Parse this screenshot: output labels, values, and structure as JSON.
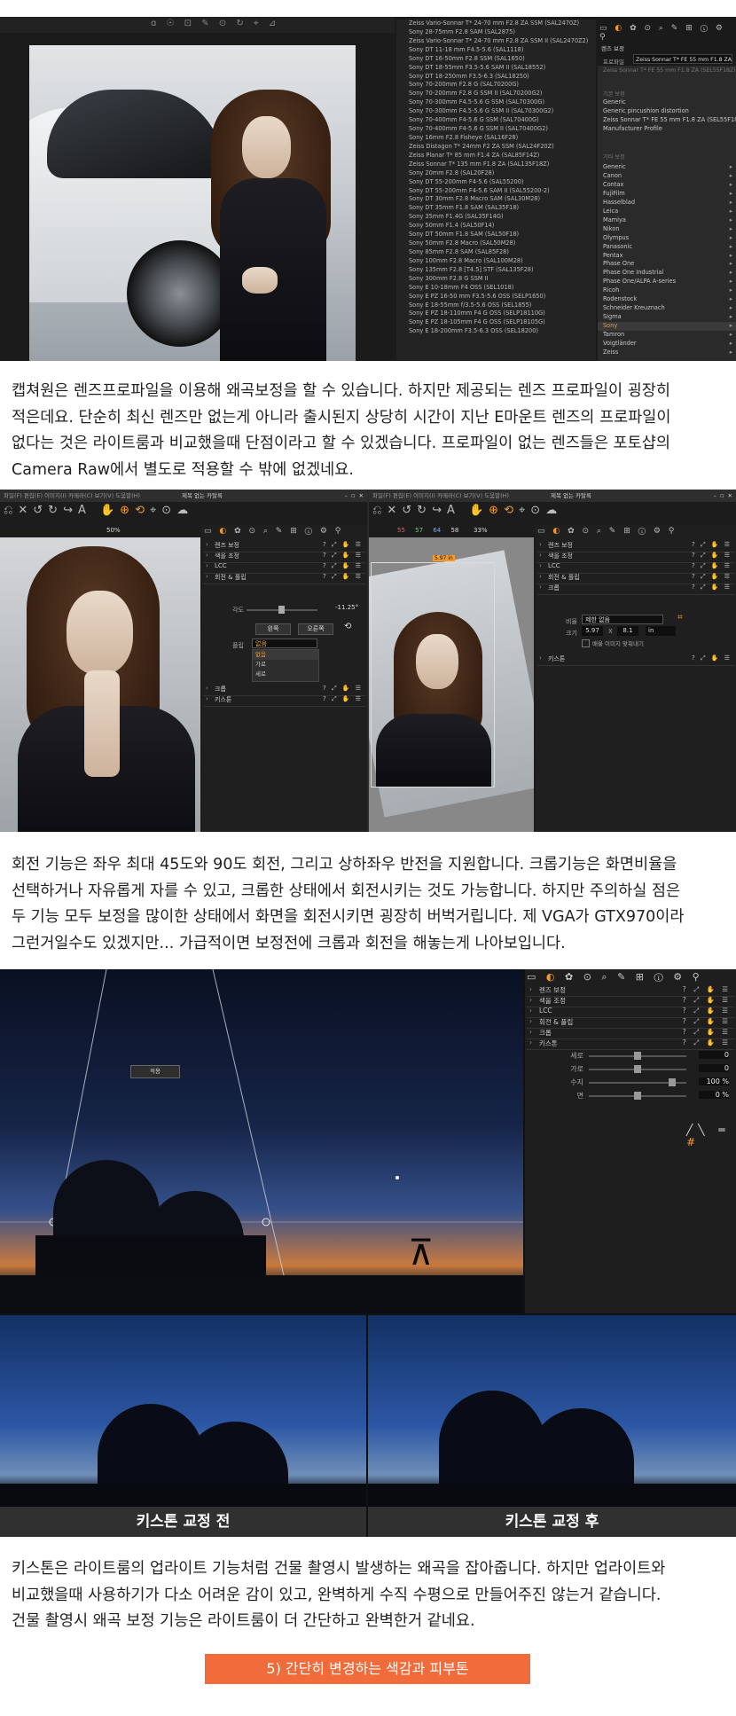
{
  "section1": {
    "lens_list": [
      "Zeiss Vario-Sonnar T* 24-70 mm F2.8 ZA SSM (SAL2470Z)",
      "Sony 28-75mm F2.8 SAM (SAL2875)",
      "Zeiss Vario-Sonnar T* 24-70 mm F2.8 ZA SSM II (SAL2470Z2)",
      "Sony DT 11-18 mm F4.5-5.6 (SAL1118)",
      "Sony DT 16-50mm F2.8 SSM (SAL1650)",
      "Sony DT 18-55mm F3.5-5.6 SAM II (SAL18552)",
      "Sony DT 18-250mm F3.5-6.3 (SAL18250)",
      "Sony 70-200mm F2.8 G (SAL70200G)",
      "Sony 70-200mm F2.8 G SSM II (SAL70200G2)",
      "Sony 70-300mm F4.5-5.6 G SSM (SAL70300G)",
      "Sony 70-300mm F4.5-5.6 G SSM II (SAL70300G2)",
      "Sony 70-400mm F4-5.6 G SSM (SAL70400G)",
      "Sony 70-400mm F4-5.6 G SSM II (SAL70400G2)",
      "Sony 16mm F2.8 Fisheye (SAL16F28)",
      "Zeiss Distagon T* 24mm F2 ZA SSM (SAL24F20Z)",
      "Zeiss Planar T* 85 mm F1.4 ZA (SAL85F14Z)",
      "Zeiss Sonnar T* 135 mm F1.8 ZA (SAL135F18Z)",
      "Sony 20mm F2.8 (SAL20F28)",
      "Sony DT 55-200mm F4-5.6 (SAL55200)",
      "Sony DT 55-200mm F4-5.6 SAM II (SAL55200-2)",
      "Sony DT 30mm F2.8 Macro SAM (SAL30M28)",
      "Sony DT 35mm F1.8 SAM (SAL35F18)",
      "Sony 35mm F1.4G (SAL35F14G)",
      "Sony 50mm F1.4 (SAL50F14)",
      "Sony DT 50mm F1.8 SAM (SAL50F18)",
      "Sony 50mm F2.8 Macro (SAL50M28)",
      "Sony 85mm F2.8 SAM (SAL85F28)",
      "Sony 100mm F2.8 Macro (SAL100M28)",
      "Sony 135mm F2.8 [T4.5] STF (SAL135F28)",
      "Sony 300mm F2.8 G SSM II",
      "Sony E 10-18mm F4 OSS (SEL1018)",
      "Sony E PZ 16-50 mm F3.5-5.6 OSS (SELP1650)",
      "Sony E 18-55mm f/3.5-5.6 OSS (SEL1855)",
      "Sony E PZ 18-110mm F4 G OSS (SELP18110G)",
      "Sony E PZ 18-105mm F4 G OSS (SELP18105G)",
      "Sony E 18-200mm F3.5-6.3 OSS (SEL18200)"
    ],
    "panel_title": "렌즈 보정",
    "profile_label": "프로파일",
    "profile_value": "Zeiss Sonnar T* FE 55 mm F1.8 ZA (S",
    "profile_sub": "Zeiss Sonnar T* FE 55 mm F1.8 ZA (SEL55F18Z)",
    "menu_head1": "기본 보정",
    "menu_items_a": [
      "Generic",
      "Generic pincushion distortion",
      "Zeiss Sonnar T* FE 55 mm F1.8 ZA (SEL55F18Z)",
      "Manufacturer Profile"
    ],
    "menu_head2": "기타 보정",
    "menu_items_b": [
      "Generic",
      "Canon",
      "Contax",
      "FujiFilm",
      "Hasselblad",
      "Leica",
      "Mamiya",
      "Nikon",
      "Olympus",
      "Panasonic",
      "Pentax",
      "Phase One",
      "Phase One Industrial",
      "Phase One/ALPA A-series",
      "Ricoh",
      "Rodenstock",
      "Schneider Kreuznach",
      "Sigma",
      "Sony",
      "Tamron",
      "Voigtländer",
      "Zeiss"
    ],
    "selected_item": "Sony"
  },
  "para1": [
    "캡쳐원은 렌즈프로파일을 이용해 왜곡보정을 할 수 있습니다. 하지만 제공되는 렌즈 프로파일이 굉장히",
    "적은데요. 단순히 최신 렌즈만 없는게 아니라 출시된지 상당히 시간이 지난 E마운트 렌즈의 프로파일이",
    "없다는 것은 라이트룸과 비교했을때 단점이라고 할 수 있겠습니다. 프로파일이 없는 렌즈들은 포토샵의",
    "Camera Raw에서 별도로 적용할 수 밖에 없겠네요."
  ],
  "section2": {
    "left": {
      "window_title": "제목 없는 카탈록",
      "zoom": "50%",
      "tools": [
        "렌즈 보정",
        "색을 조정",
        "LCC",
        "회전 & 플립"
      ],
      "angle_label": "각도",
      "angle_value": "-11.25°",
      "left_btn": "왼쪽",
      "right_btn": "오른쪽",
      "flip_label": "플립",
      "flip_value": "없음",
      "flip_options": [
        "없음",
        "가로",
        "세로"
      ],
      "tools_after": [
        "크롭",
        "키스톤"
      ]
    },
    "right": {
      "window_title": "제목 없는 카탈록",
      "rgb": [
        "55",
        "57",
        "64",
        "58"
      ],
      "zoom": "33%",
      "tools": [
        "렌즈 보정",
        "색을 조정",
        "LCC",
        "회전 & 플립",
        "크롭"
      ],
      "ratio_label": "비율",
      "ratio_value": "제한 없음",
      "size_label": "크기",
      "size_w": "5.97",
      "size_x": "X",
      "size_h": "8.1",
      "size_unit": "in",
      "checkbox_label": "배율 이미지 맞춰내기",
      "tools_after": [
        "키스톤"
      ],
      "crop_tag": "5.97 in"
    }
  },
  "para2": [
    "회전 기능은 좌우 최대 45도와 90도 회전, 그리고 상하좌우 반전을 지원합니다. 크롭기능은 화면비율을",
    "선택하거나 자유롭게 자를 수 있고, 크롭한 상태에서 회전시키는 것도 가능합니다. 하지만 주의하실 점은",
    "두 기능 모두 보정을 많이한 상태에서 화면을 회전시키면 굉장히 버벅거립니다. 제 VGA가 GTX970이라",
    "그런거일수도 있겠지만... 가급적이면 보정전에 크롭과 회전을 해놓는게 나아보입니다."
  ],
  "section3": {
    "apply_btn": "적용",
    "tools": [
      "렌즈 보정",
      "색을 조정",
      "LCC",
      "회전 & 플립",
      "크롭",
      "키스톤"
    ],
    "sliders": [
      {
        "label": "세로",
        "value": "0",
        "pos": 0.5
      },
      {
        "label": "가로",
        "value": "0",
        "pos": 0.5
      },
      {
        "label": "수지",
        "value": "100 %",
        "pos": 0.85
      },
      {
        "label": "면",
        "value": "0 %",
        "pos": 0.5
      }
    ],
    "before_label": "키스톤 교정 전",
    "after_label": "키스톤 교정 후"
  },
  "para3": [
    "키스톤은 라이트룸의 업라이트 기능처럼 건물 촬영시 발생하는 왜곡을 잡아줍니다. 하지만 업라이트와",
    "비교했을때 사용하기가 다소 어려운 감이 있고, 완벽하게 수직 수평으로 만들어주진 않는거 같습니다.",
    "건물 촬영시 왜곡 보정 기능은 라이트룸이 더 간단하고 완벽한거 같네요."
  ],
  "section_button": "5) 간단히 변경하는 색감과 피부톤",
  "colors": {
    "accent": "#f26b3a",
    "panel_bg": "#1e1e1e",
    "tool_orange": "#f39a2a"
  }
}
